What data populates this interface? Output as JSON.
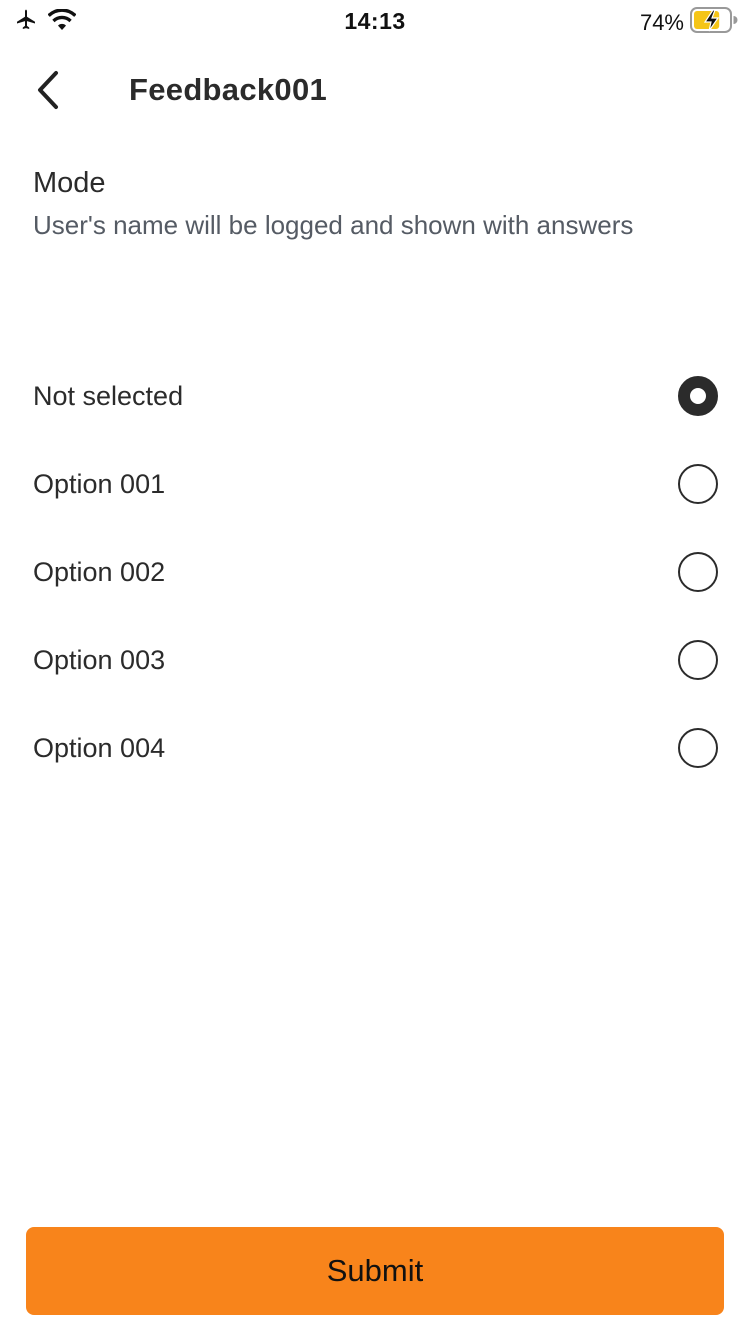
{
  "status_bar": {
    "time": "14:13",
    "battery_percent": "74%",
    "icons": [
      "airplane-icon",
      "wifi-icon",
      "battery-charging-icon"
    ],
    "battery_level": 0.74,
    "battery_color": "#f5c518"
  },
  "header": {
    "title": "Feedback001",
    "back_icon": "chevron-left-icon"
  },
  "mode": {
    "title": "Mode",
    "description": "User's name will be logged and shown with answers"
  },
  "options": [
    {
      "label": "Not selected",
      "selected": true
    },
    {
      "label": "Option 001",
      "selected": false
    },
    {
      "label": "Option 002",
      "selected": false
    },
    {
      "label": "Option 003",
      "selected": false
    },
    {
      "label": "Option 004",
      "selected": false
    }
  ],
  "submit": {
    "label": "Submit",
    "color": "#f8841b"
  }
}
